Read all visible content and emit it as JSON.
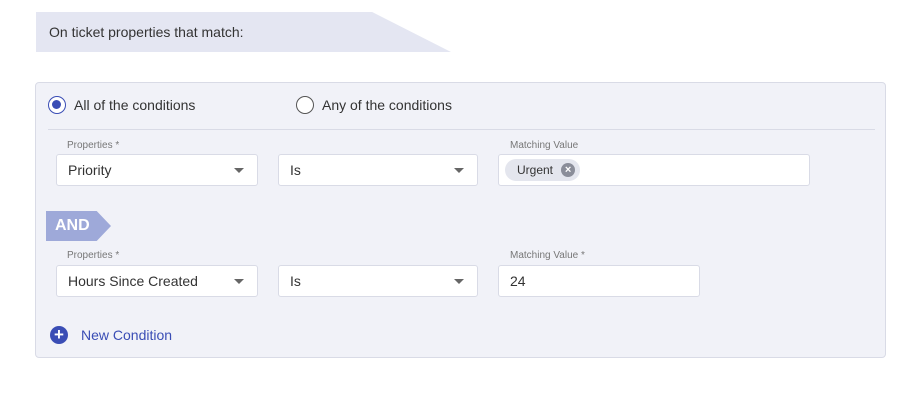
{
  "header": {
    "title": "On ticket properties that match:"
  },
  "match_mode": {
    "all_label": "All of the conditions",
    "any_label": "Any of the conditions",
    "selected": "all"
  },
  "conditions": [
    {
      "property_label": "Properties *",
      "property_value": "Priority",
      "operator_value": "Is",
      "value_label": "Matching Value",
      "value_chip": "Urgent"
    },
    {
      "property_label": "Properties *",
      "property_value": "Hours Since Created",
      "operator_value": "Is",
      "value_label": "Matching Value *",
      "value_text": "24"
    }
  ],
  "connector": "AND",
  "actions": {
    "new_condition_label": "New Condition"
  },
  "icons": {
    "remove_chip": "close-circle-icon",
    "add": "plus-circle-icon",
    "dropdown": "caret-down-icon"
  },
  "colors": {
    "accent": "#3a4db5",
    "badge": "#9ea9d9",
    "panel_bg": "#f1f2f8"
  }
}
